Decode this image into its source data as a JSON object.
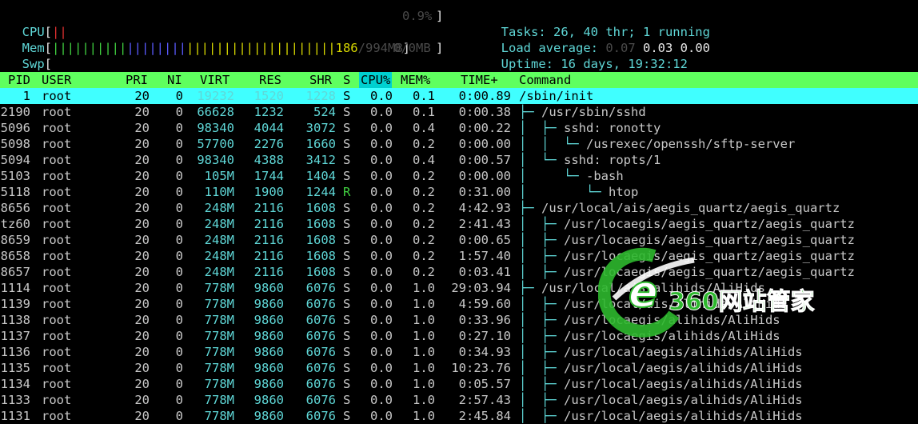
{
  "meters": {
    "cpu": {
      "label": "CPU",
      "bar": "||",
      "value": "0.9%"
    },
    "mem": {
      "label": "Mem",
      "bar_a": "||||||||||",
      "bar_b": "||||||||",
      "bar_c": "||||||||||||||||||||",
      "used": "186",
      "sep": "/",
      "total": "994MB"
    },
    "swp": {
      "label": "Swp",
      "value": "0/0MB"
    }
  },
  "summary": {
    "tasks_label": "Tasks: ",
    "tasks_value": "26, 40 thr; 1 running",
    "load_label": "Load average: ",
    "load_1": "0.07",
    "load_5": "0.03",
    "load_15": "0.00",
    "uptime_label": "Uptime: ",
    "uptime_value": "16 days, 19:32:12"
  },
  "columns": [
    "PID",
    "USER",
    "PRI",
    "NI",
    "VIRT",
    "RES",
    "SHR",
    "S",
    "CPU%",
    "MEM%",
    "TIME+",
    "Command"
  ],
  "processes": [
    {
      "pid": "1",
      "user": "root",
      "pri": "20",
      "ni": "0",
      "virt": "19232",
      "res": "1520",
      "shr": "1228",
      "s": "S",
      "cpu": "0.0",
      "mem": "0.1",
      "time": "0:00.89",
      "tree": "",
      "cmd": "/sbin/init",
      "selected": true
    },
    {
      "pid": "2190",
      "user": "root",
      "pri": "20",
      "ni": "0",
      "virt": "66628",
      "res": "1232",
      "shr": "524",
      "s": "S",
      "cpu": "0.0",
      "mem": "0.1",
      "time": "0:00.38",
      "tree": "├─ ",
      "cmd": "/usr/sbin/sshd"
    },
    {
      "pid": "5096",
      "user": "root",
      "pri": "20",
      "ni": "0",
      "virt": "98340",
      "res": "4044",
      "shr": "3072",
      "s": "S",
      "cpu": "0.0",
      "mem": "0.4",
      "time": "0:00.22",
      "tree": "│  ├─ ",
      "cmd": "sshd: ronotty"
    },
    {
      "pid": "5098",
      "user": "root",
      "pri": "20",
      "ni": "0",
      "virt": "57700",
      "res": "2276",
      "shr": "1660",
      "s": "S",
      "cpu": "0.0",
      "mem": "0.2",
      "time": "0:00.00",
      "tree": "│  │  └─ ",
      "cmd": "/usrexec/openssh/sftp-server"
    },
    {
      "pid": "5094",
      "user": "root",
      "pri": "20",
      "ni": "0",
      "virt": "98340",
      "res": "4388",
      "shr": "3412",
      "s": "S",
      "cpu": "0.0",
      "mem": "0.4",
      "time": "0:00.57",
      "tree": "│  └─ ",
      "cmd": "sshd: ropts/1"
    },
    {
      "pid": "5103",
      "user": "root",
      "pri": "20",
      "ni": "0",
      "virt": "105M",
      "res": "1744",
      "shr": "1404",
      "s": "S",
      "cpu": "0.0",
      "mem": "0.2",
      "time": "0:00.00",
      "tree": "│     └─ ",
      "cmd": "-bash"
    },
    {
      "pid": "5118",
      "user": "root",
      "pri": "20",
      "ni": "0",
      "virt": "110M",
      "res": "1900",
      "shr": "1244",
      "s": "R",
      "cpu": "0.0",
      "mem": "0.2",
      "time": "0:31.00",
      "tree": "│        └─ ",
      "cmd": "htop"
    },
    {
      "pid": "8656",
      "user": "root",
      "pri": "20",
      "ni": "0",
      "virt": "248M",
      "res": "2116",
      "shr": "1608",
      "s": "S",
      "cpu": "0.0",
      "mem": "0.2",
      "time": "4:42.93",
      "tree": "├─ ",
      "cmd": "/usr/local/ais/aegis_quartz/aegis_quartz"
    },
    {
      "pid": "tz60",
      "user": "root",
      "pri": "20",
      "ni": "0",
      "virt": "248M",
      "res": "2116",
      "shr": "1608",
      "s": "S",
      "cpu": "0.0",
      "mem": "0.2",
      "time": "2:41.43",
      "tree": "│  ├─ ",
      "cmd": "/usr/locaegis/aegis_quartz/aegis_quartz"
    },
    {
      "pid": "8659",
      "user": "root",
      "pri": "20",
      "ni": "0",
      "virt": "248M",
      "res": "2116",
      "shr": "1608",
      "s": "S",
      "cpu": "0.0",
      "mem": "0.2",
      "time": "0:00.65",
      "tree": "│  ├─ ",
      "cmd": "/usr/locaegis/aegis_quartz/aegis_quartz"
    },
    {
      "pid": "8658",
      "user": "root",
      "pri": "20",
      "ni": "0",
      "virt": "248M",
      "res": "2116",
      "shr": "1608",
      "s": "S",
      "cpu": "0.0",
      "mem": "0.2",
      "time": "1:57.40",
      "tree": "│  ├─ ",
      "cmd": "/usr/locaegis/aegis_quartz/aegis_quartz"
    },
    {
      "pid": "8657",
      "user": "root",
      "pri": "20",
      "ni": "0",
      "virt": "248M",
      "res": "2116",
      "shr": "1608",
      "s": "S",
      "cpu": "0.0",
      "mem": "0.2",
      "time": "0:03.41",
      "tree": "│  ├─ ",
      "cmd": "/usr/locaegis/aegis_quartz/aegis_quartz"
    },
    {
      "pid": "1114",
      "user": "root",
      "pri": "20",
      "ni": "0",
      "virt": "778M",
      "res": "9860",
      "shr": "6076",
      "s": "S",
      "cpu": "0.0",
      "mem": "1.0",
      "time": "29:03.94",
      "tree": "├─ ",
      "cmd": "/usr/local/ais/alihids/AliHids"
    },
    {
      "pid": "1139",
      "user": "root",
      "pri": "20",
      "ni": "0",
      "virt": "778M",
      "res": "9860",
      "shr": "6076",
      "s": "S",
      "cpu": "0.0",
      "mem": "1.0",
      "time": "4:59.60",
      "tree": "│  ├─ ",
      "cmd": "/usr/local/ais/alihids/AliHids"
    },
    {
      "pid": "1138",
      "user": "root",
      "pri": "20",
      "ni": "0",
      "virt": "778M",
      "res": "9860",
      "shr": "6076",
      "s": "S",
      "cpu": "0.0",
      "mem": "1.0",
      "time": "0:33.96",
      "tree": "│  ├─ ",
      "cmd": "/usr/locaegis/alihids/AliHids"
    },
    {
      "pid": "1137",
      "user": "root",
      "pri": "20",
      "ni": "0",
      "virt": "778M",
      "res": "9860",
      "shr": "6076",
      "s": "S",
      "cpu": "0.0",
      "mem": "1.0",
      "time": "0:27.10",
      "tree": "│  ├─ ",
      "cmd": "/usr/locaegis/alihids/AliHids"
    },
    {
      "pid": "1136",
      "user": "root",
      "pri": "20",
      "ni": "0",
      "virt": "778M",
      "res": "9860",
      "shr": "6076",
      "s": "S",
      "cpu": "0.0",
      "mem": "1.0",
      "time": "0:34.93",
      "tree": "│  ├─ ",
      "cmd": "/usr/local/aegis/alihids/AliHids"
    },
    {
      "pid": "1135",
      "user": "root",
      "pri": "20",
      "ni": "0",
      "virt": "778M",
      "res": "9860",
      "shr": "6076",
      "s": "S",
      "cpu": "0.0",
      "mem": "1.0",
      "time": "10:23.76",
      "tree": "│  ├─ ",
      "cmd": "/usr/local/aegis/alihids/AliHids"
    },
    {
      "pid": "1134",
      "user": "root",
      "pri": "20",
      "ni": "0",
      "virt": "778M",
      "res": "9860",
      "shr": "6076",
      "s": "S",
      "cpu": "0.0",
      "mem": "1.0",
      "time": "0:05.57",
      "tree": "│  ├─ ",
      "cmd": "/usr/local/aegis/alihids/AliHids"
    },
    {
      "pid": "1133",
      "user": "root",
      "pri": "20",
      "ni": "0",
      "virt": "778M",
      "res": "9860",
      "shr": "6076",
      "s": "S",
      "cpu": "0.0",
      "mem": "1.0",
      "time": "2:57.43",
      "tree": "│  ├─ ",
      "cmd": "/usr/local/aegis/alihids/AliHids"
    },
    {
      "pid": "1131",
      "user": "root",
      "pri": "20",
      "ni": "0",
      "virt": "778M",
      "res": "9860",
      "shr": "6076",
      "s": "S",
      "cpu": "0.0",
      "mem": "1.0",
      "time": "2:45.84",
      "tree": "│  ├─ ",
      "cmd": "/usr/local/aegis/alihids/AliHids"
    }
  ],
  "watermark": {
    "text": "360网站管家",
    "letter": "e"
  },
  "colors": {
    "header_bg": "#5fff5f",
    "cpu_header_bg": "#00d0d0",
    "selected_bg": "#40ffff",
    "cyan": "#5fd7d7",
    "watermark": "#2db82d"
  }
}
